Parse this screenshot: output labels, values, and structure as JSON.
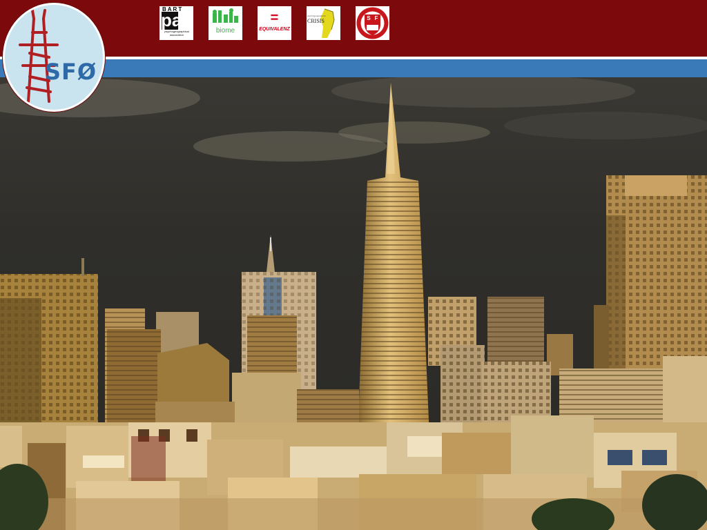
{
  "brand": {
    "logo_text": "SFØ",
    "colors": {
      "header": "#7c0a0c",
      "band": "#3b7ab8",
      "logo_bg": "#c9e3ef",
      "tower": "#b01f22"
    }
  },
  "partners": [
    {
      "id": "bart-psychogeographical",
      "top": "BART",
      "big": "pa",
      "small": "psychogeographical association",
      "icon": "bart-pa-logo"
    },
    {
      "id": "biome",
      "label": "biome",
      "icon": "biome-logo"
    },
    {
      "id": "equivalenz",
      "symbol": "=",
      "label": "EQUIVALENZ",
      "icon": "equivalenz-logo"
    },
    {
      "id": "crisis",
      "label": "CRISIS",
      "small": "psychogeographical",
      "icon": "crisis-fist-logo"
    },
    {
      "id": "seal",
      "letters": [
        "S",
        "F"
      ],
      "icon": "shield-seal-logo"
    }
  ],
  "hero": {
    "subject": "city-skyline-photo",
    "icon": "skyline-image"
  }
}
